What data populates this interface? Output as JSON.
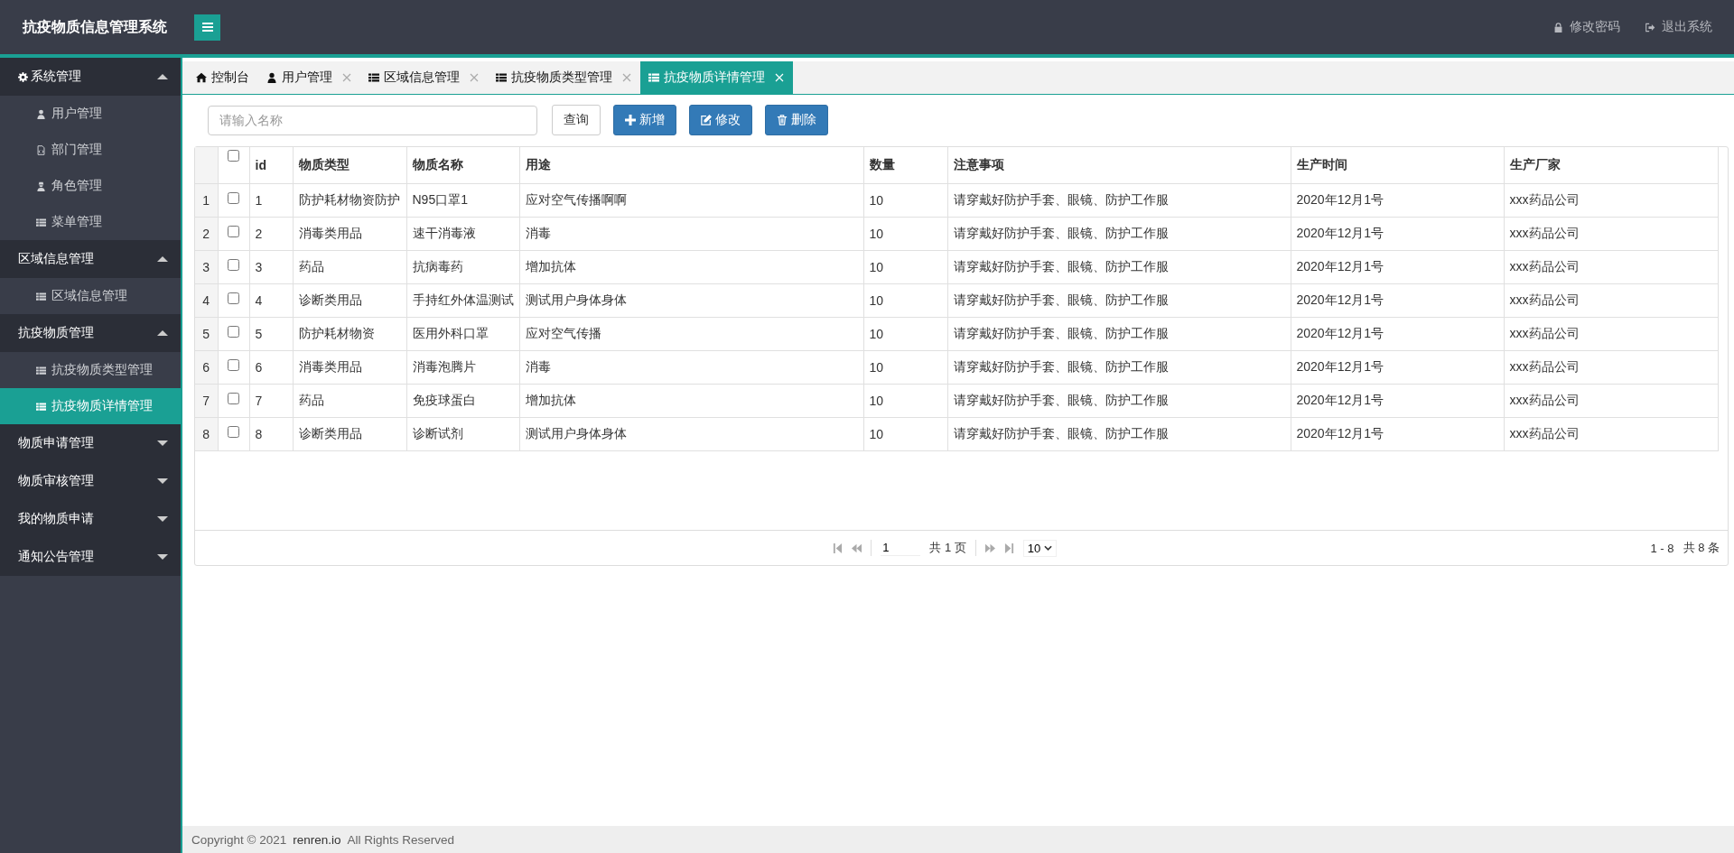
{
  "header": {
    "title": "抗疫物质信息管理系统",
    "links": [
      {
        "label": "修改密码"
      },
      {
        "label": "退出系统"
      }
    ]
  },
  "sidebar": {
    "groups": [
      {
        "label": "系统管理",
        "expanded": true,
        "children": [
          {
            "label": "用户管理",
            "selected": false
          },
          {
            "label": "部门管理",
            "selected": false
          },
          {
            "label": "角色管理",
            "selected": false
          },
          {
            "label": "菜单管理",
            "selected": false
          }
        ]
      },
      {
        "label": "区域信息管理",
        "expanded": true,
        "children": [
          {
            "label": "区域信息管理",
            "selected": false
          }
        ]
      },
      {
        "label": "抗疫物质管理",
        "expanded": true,
        "children": [
          {
            "label": "抗疫物质类型管理",
            "selected": false
          },
          {
            "label": "抗疫物质详情管理",
            "selected": true
          }
        ]
      },
      {
        "label": "物质申请管理",
        "expanded": false
      },
      {
        "label": "物质审核管理",
        "expanded": false
      },
      {
        "label": "我的物质申请",
        "expanded": false
      },
      {
        "label": "通知公告管理",
        "expanded": false
      }
    ]
  },
  "tabs": [
    {
      "label": "控制台",
      "closable": false,
      "selected": false
    },
    {
      "label": "用户管理",
      "closable": true,
      "selected": false
    },
    {
      "label": "区域信息管理",
      "closable": true,
      "selected": false
    },
    {
      "label": "抗疫物质类型管理",
      "closable": true,
      "selected": false
    },
    {
      "label": "抗疫物质详情管理",
      "closable": true,
      "selected": true
    }
  ],
  "toolbar": {
    "search": {
      "placeholder": "请输入名称"
    },
    "buttons": [
      {
        "label": "查询",
        "kind": "default"
      },
      {
        "label": "新增",
        "kind": "primary"
      },
      {
        "label": "修改",
        "kind": "primary"
      },
      {
        "label": "删除",
        "kind": "primary"
      }
    ]
  },
  "table": {
    "header_checkbox": {
      "checked": false
    },
    "columns": [
      "id",
      "物质类型",
      "物质名称",
      "用途",
      "数量",
      "注意事项",
      "生产时间",
      "生产厂家"
    ],
    "rows": [
      {
        "number": "1",
        "checked": false,
        "cells": [
          "1",
          "防护耗材物资防护",
          "N95口罩1",
          "应对空气传播啊啊",
          "10",
          "请穿戴好防护手套、眼镜、防护工作服",
          "2020年12月1号",
          "xxx药品公司"
        ]
      },
      {
        "number": "2",
        "checked": false,
        "cells": [
          "2",
          "消毒类用品",
          "速干消毒液",
          "消毒",
          "10",
          "请穿戴好防护手套、眼镜、防护工作服",
          "2020年12月1号",
          "xxx药品公司"
        ]
      },
      {
        "number": "3",
        "checked": false,
        "cells": [
          "3",
          "药品",
          "抗病毒药",
          "增加抗体",
          "10",
          "请穿戴好防护手套、眼镜、防护工作服",
          "2020年12月1号",
          "xxx药品公司"
        ]
      },
      {
        "number": "4",
        "checked": false,
        "cells": [
          "4",
          "诊断类用品",
          "手持红外体温测试",
          "测试用户身体身体",
          "10",
          "请穿戴好防护手套、眼镜、防护工作服",
          "2020年12月1号",
          "xxx药品公司"
        ]
      },
      {
        "number": "5",
        "checked": false,
        "cells": [
          "5",
          "防护耗材物资",
          "医用外科口罩",
          "应对空气传播",
          "10",
          "请穿戴好防护手套、眼镜、防护工作服",
          "2020年12月1号",
          "xxx药品公司"
        ]
      },
      {
        "number": "6",
        "checked": false,
        "cells": [
          "6",
          "消毒类用品",
          "消毒泡腾片",
          "消毒",
          "10",
          "请穿戴好防护手套、眼镜、防护工作服",
          "2020年12月1号",
          "xxx药品公司"
        ]
      },
      {
        "number": "7",
        "checked": false,
        "cells": [
          "7",
          "药品",
          "免疫球蛋白",
          "增加抗体",
          "10",
          "请穿戴好防护手套、眼镜、防护工作服",
          "2020年12月1号",
          "xxx药品公司"
        ]
      },
      {
        "number": "8",
        "checked": false,
        "cells": [
          "8",
          "诊断类用品",
          "诊断试剂",
          "测试用户身体身体",
          "10",
          "请穿戴好防护手套、眼镜、防护工作服",
          "2020年12月1号",
          "xxx药品公司"
        ]
      }
    ]
  },
  "pagination": {
    "page": "1",
    "total_pages": "共 1 页",
    "page_size": "10",
    "range": "1 - 8",
    "total": "共 8 条"
  },
  "footer": {
    "copyright": "Copyright © 2021",
    "link": "renren.io",
    "rights": "All Rights Reserved"
  }
}
